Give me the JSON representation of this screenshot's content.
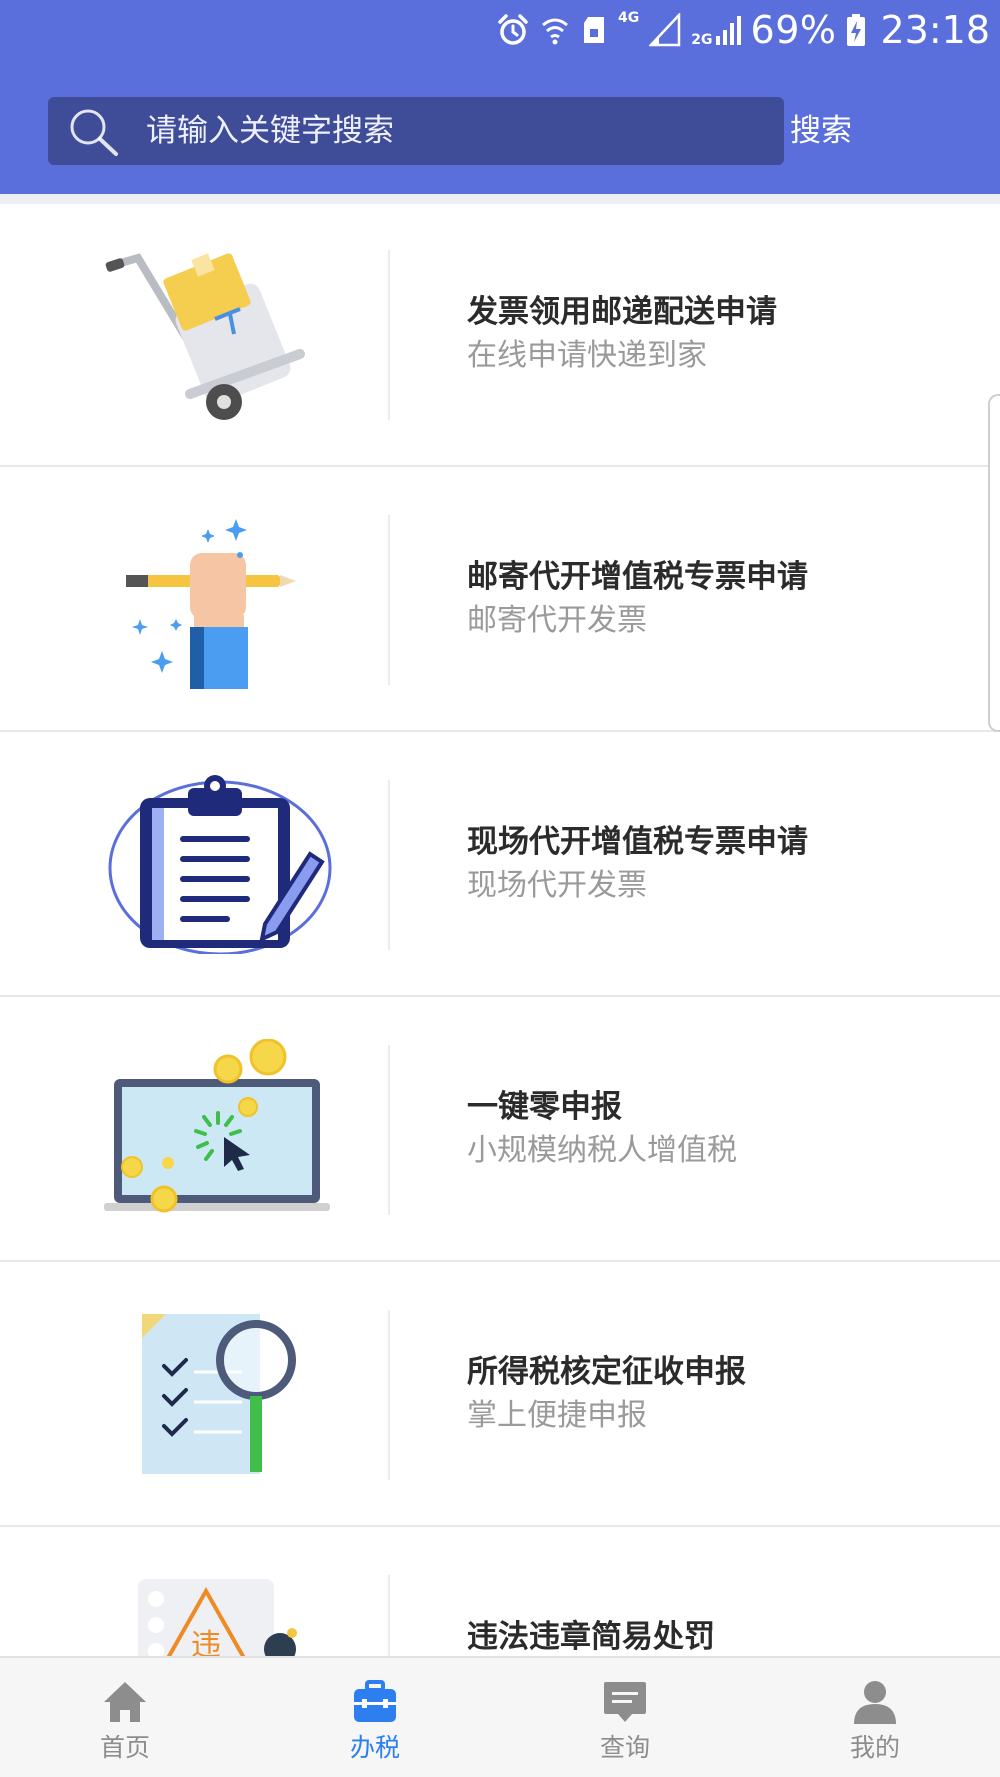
{
  "status_bar": {
    "network_4g": "4G",
    "network_2g": "2G",
    "battery": "69%",
    "time": "23:18",
    "icons": [
      "alarm-icon",
      "wifi-icon",
      "sim-icon",
      "signal-icon",
      "signal-icon",
      "battery-charging-icon"
    ]
  },
  "search": {
    "placeholder": "请输入关键字搜索",
    "button_label": "搜索"
  },
  "services": [
    {
      "title": "发票领用邮递配送申请",
      "subtitle": "在线申请快递到家",
      "icon": "delivery-cart-icon"
    },
    {
      "title": "邮寄代开增值税专票申请",
      "subtitle": "邮寄代开发票",
      "icon": "hand-pencil-icon"
    },
    {
      "title": "现场代开增值税专票申请",
      "subtitle": "现场代开发票",
      "icon": "clipboard-pen-icon"
    },
    {
      "title": "一键零申报",
      "subtitle": "小规模纳税人增值税",
      "icon": "laptop-coins-icon"
    },
    {
      "title": "所得税核定征收申报",
      "subtitle": "掌上便捷申报",
      "icon": "document-magnifier-icon"
    },
    {
      "title": "违法违章简易处罚",
      "subtitle": "",
      "icon_text": "违",
      "icon": "violation-warning-icon"
    }
  ],
  "bottom_nav": {
    "active": "办税",
    "active_color": "#2d7ff0",
    "inactive_color": "#8d8d8d",
    "tabs": [
      {
        "label": "首页",
        "icon": "home-icon"
      },
      {
        "label": "办税",
        "icon": "briefcase-icon"
      },
      {
        "label": "查询",
        "icon": "chat-icon"
      },
      {
        "label": "我的",
        "icon": "person-icon"
      }
    ]
  },
  "colors": {
    "header": "#5a6fdb",
    "search_box": "#3f4d98"
  }
}
